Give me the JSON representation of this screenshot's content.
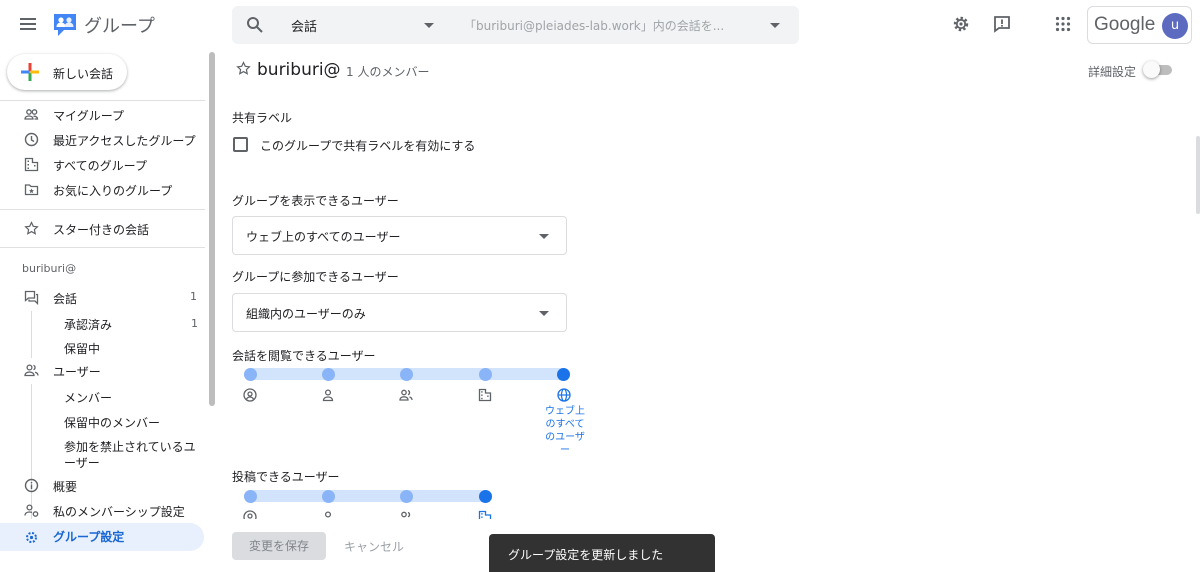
{
  "header": {
    "app_title": "グループ",
    "search_scope": "会話",
    "search_placeholder": "「buriburi@pleiades-lab.work」内の会話を...",
    "google_label": "Google",
    "avatar_letter": "u"
  },
  "sidebar": {
    "new_conversation": "新しい会話",
    "nav": [
      {
        "label": "マイグループ",
        "icon": "groups-icon"
      },
      {
        "label": "最近アクセスしたグループ",
        "icon": "clock-icon"
      },
      {
        "label": "すべてのグループ",
        "icon": "building-icon"
      },
      {
        "label": "お気に入りのグループ",
        "icon": "folder-star-icon"
      }
    ],
    "starred": "スター付きの会話",
    "group_name": "buriburi@",
    "conversations": {
      "label": "会話",
      "count": "1"
    },
    "approved": {
      "label": "承認済み",
      "count": "1"
    },
    "pending": {
      "label": "保留中"
    },
    "users": {
      "label": "ユーザー"
    },
    "members": "メンバー",
    "pending_members": "保留中のメンバー",
    "banned_users_line1": "参加を禁止されているユ",
    "banned_users_line2": "ーザー",
    "overview": "概要",
    "my_membership": "私のメンバーシップ設定",
    "group_settings": "グループ設定"
  },
  "main": {
    "title": "buriburi@",
    "member_count": "1 人のメンバー",
    "advanced_settings": "詳細設定",
    "advanced_toggle_on": false,
    "shared_labels_heading": "共有ラベル",
    "shared_labels_checkbox": "このグループで共有ラベルを有効にする",
    "shared_labels_checked": false,
    "who_can_see_group": "グループを表示できるユーザー",
    "who_can_see_value": "ウェブ上のすべてのユーザー",
    "who_can_join": "グループに参加できるユーザー",
    "who_can_join_value": "組織内のユーザーのみ",
    "who_can_view_conversations": "会話を閲覧できるユーザー",
    "view_levels": [
      "group-managers",
      "group-members",
      "all-members",
      "organization",
      "web"
    ],
    "view_selected": 4,
    "web_caption": "ウェブ上のすべてのユーザー",
    "who_can_post": "投稿できるユーザー",
    "post_levels": [
      "group-managers",
      "group-members",
      "all-members",
      "organization"
    ],
    "post_selected": 3,
    "save_button": "変更を保存",
    "cancel_button": "キャンセル"
  },
  "snackbar": "グループ設定を更新しました",
  "colors": {
    "accent": "#1a73e8",
    "track": "#d2e3fc",
    "dot": "#8ab4f8",
    "snackbar_bg": "#323232"
  }
}
